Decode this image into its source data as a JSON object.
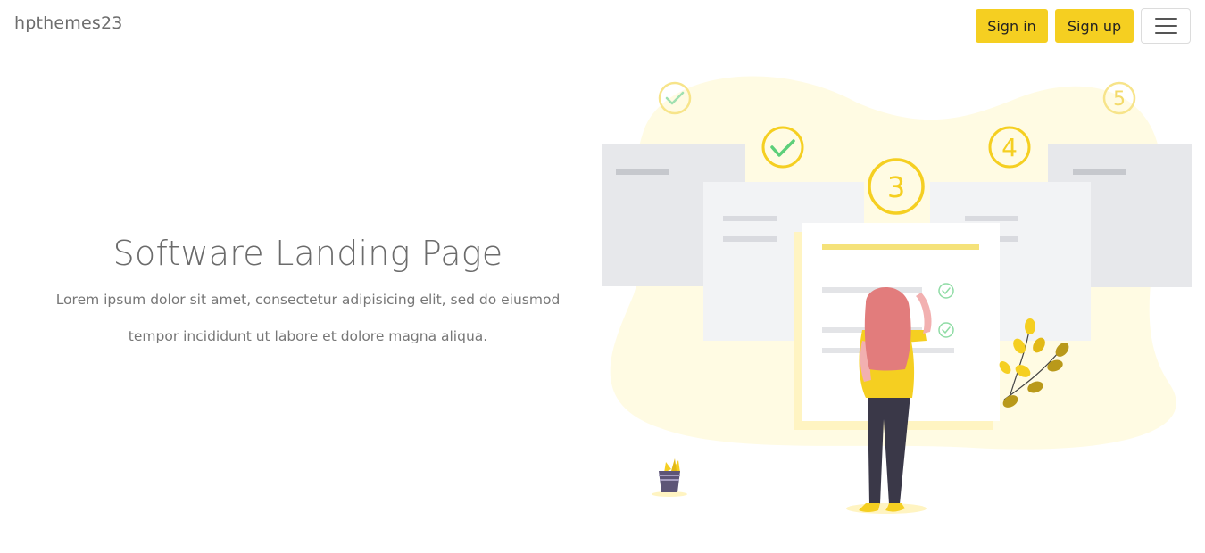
{
  "navbar": {
    "brand": "hpthemes23",
    "sign_in_label": "Sign in",
    "sign_up_label": "Sign up"
  },
  "hero": {
    "title": "Software Landing Page",
    "description": "Lorem ipsum dolor sit amet, consectetur adipisicing elit, sed do eiusmod tempor incididunt ut labore et dolore magna aliqua."
  },
  "illustration": {
    "step_numbers": [
      "3",
      "4",
      "5"
    ]
  },
  "colors": {
    "accent": "#f5cf21",
    "text": "#6b6b6b",
    "blob": "#fffbe3",
    "card_gray": "#e8e9ec",
    "check_green": "#5ccf7a"
  }
}
